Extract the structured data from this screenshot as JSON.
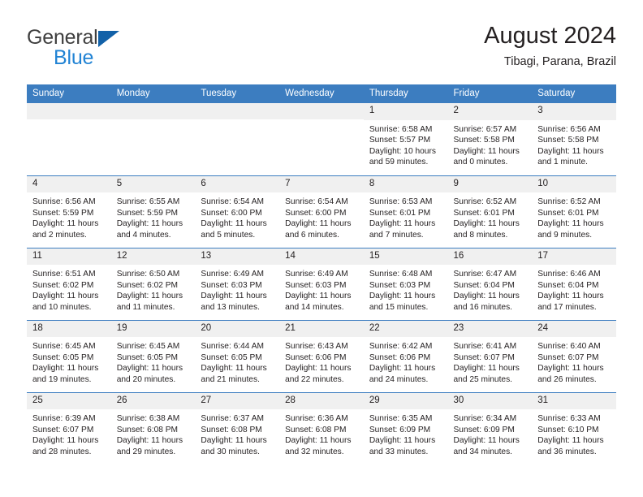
{
  "brand": {
    "name_top": "General",
    "name_bottom": "Blue",
    "triangle_color": "#1261a8",
    "blue_text_color": "#2183d4"
  },
  "header": {
    "title": "August 2024",
    "subtitle": "Tibagi, Parana, Brazil"
  },
  "theme": {
    "header_row_bg": "#3c7dc0",
    "header_row_text": "#ffffff",
    "day_number_bg": "#f0f0f0",
    "cell_text": "#231f20"
  },
  "weekday_headers": [
    "Sunday",
    "Monday",
    "Tuesday",
    "Wednesday",
    "Thursday",
    "Friday",
    "Saturday"
  ],
  "weeks": [
    [
      {
        "day": "",
        "sunrise": "",
        "sunset": "",
        "daylight": "",
        "empty": true
      },
      {
        "day": "",
        "sunrise": "",
        "sunset": "",
        "daylight": "",
        "empty": true
      },
      {
        "day": "",
        "sunrise": "",
        "sunset": "",
        "daylight": "",
        "empty": true
      },
      {
        "day": "",
        "sunrise": "",
        "sunset": "",
        "daylight": "",
        "empty": true
      },
      {
        "day": "1",
        "sunrise": "Sunrise: 6:58 AM",
        "sunset": "Sunset: 5:57 PM",
        "daylight": "Daylight: 10 hours and 59 minutes."
      },
      {
        "day": "2",
        "sunrise": "Sunrise: 6:57 AM",
        "sunset": "Sunset: 5:58 PM",
        "daylight": "Daylight: 11 hours and 0 minutes."
      },
      {
        "day": "3",
        "sunrise": "Sunrise: 6:56 AM",
        "sunset": "Sunset: 5:58 PM",
        "daylight": "Daylight: 11 hours and 1 minute."
      }
    ],
    [
      {
        "day": "4",
        "sunrise": "Sunrise: 6:56 AM",
        "sunset": "Sunset: 5:59 PM",
        "daylight": "Daylight: 11 hours and 2 minutes."
      },
      {
        "day": "5",
        "sunrise": "Sunrise: 6:55 AM",
        "sunset": "Sunset: 5:59 PM",
        "daylight": "Daylight: 11 hours and 4 minutes."
      },
      {
        "day": "6",
        "sunrise": "Sunrise: 6:54 AM",
        "sunset": "Sunset: 6:00 PM",
        "daylight": "Daylight: 11 hours and 5 minutes."
      },
      {
        "day": "7",
        "sunrise": "Sunrise: 6:54 AM",
        "sunset": "Sunset: 6:00 PM",
        "daylight": "Daylight: 11 hours and 6 minutes."
      },
      {
        "day": "8",
        "sunrise": "Sunrise: 6:53 AM",
        "sunset": "Sunset: 6:01 PM",
        "daylight": "Daylight: 11 hours and 7 minutes."
      },
      {
        "day": "9",
        "sunrise": "Sunrise: 6:52 AM",
        "sunset": "Sunset: 6:01 PM",
        "daylight": "Daylight: 11 hours and 8 minutes."
      },
      {
        "day": "10",
        "sunrise": "Sunrise: 6:52 AM",
        "sunset": "Sunset: 6:01 PM",
        "daylight": "Daylight: 11 hours and 9 minutes."
      }
    ],
    [
      {
        "day": "11",
        "sunrise": "Sunrise: 6:51 AM",
        "sunset": "Sunset: 6:02 PM",
        "daylight": "Daylight: 11 hours and 10 minutes."
      },
      {
        "day": "12",
        "sunrise": "Sunrise: 6:50 AM",
        "sunset": "Sunset: 6:02 PM",
        "daylight": "Daylight: 11 hours and 11 minutes."
      },
      {
        "day": "13",
        "sunrise": "Sunrise: 6:49 AM",
        "sunset": "Sunset: 6:03 PM",
        "daylight": "Daylight: 11 hours and 13 minutes."
      },
      {
        "day": "14",
        "sunrise": "Sunrise: 6:49 AM",
        "sunset": "Sunset: 6:03 PM",
        "daylight": "Daylight: 11 hours and 14 minutes."
      },
      {
        "day": "15",
        "sunrise": "Sunrise: 6:48 AM",
        "sunset": "Sunset: 6:03 PM",
        "daylight": "Daylight: 11 hours and 15 minutes."
      },
      {
        "day": "16",
        "sunrise": "Sunrise: 6:47 AM",
        "sunset": "Sunset: 6:04 PM",
        "daylight": "Daylight: 11 hours and 16 minutes."
      },
      {
        "day": "17",
        "sunrise": "Sunrise: 6:46 AM",
        "sunset": "Sunset: 6:04 PM",
        "daylight": "Daylight: 11 hours and 17 minutes."
      }
    ],
    [
      {
        "day": "18",
        "sunrise": "Sunrise: 6:45 AM",
        "sunset": "Sunset: 6:05 PM",
        "daylight": "Daylight: 11 hours and 19 minutes."
      },
      {
        "day": "19",
        "sunrise": "Sunrise: 6:45 AM",
        "sunset": "Sunset: 6:05 PM",
        "daylight": "Daylight: 11 hours and 20 minutes."
      },
      {
        "day": "20",
        "sunrise": "Sunrise: 6:44 AM",
        "sunset": "Sunset: 6:05 PM",
        "daylight": "Daylight: 11 hours and 21 minutes."
      },
      {
        "day": "21",
        "sunrise": "Sunrise: 6:43 AM",
        "sunset": "Sunset: 6:06 PM",
        "daylight": "Daylight: 11 hours and 22 minutes."
      },
      {
        "day": "22",
        "sunrise": "Sunrise: 6:42 AM",
        "sunset": "Sunset: 6:06 PM",
        "daylight": "Daylight: 11 hours and 24 minutes."
      },
      {
        "day": "23",
        "sunrise": "Sunrise: 6:41 AM",
        "sunset": "Sunset: 6:07 PM",
        "daylight": "Daylight: 11 hours and 25 minutes."
      },
      {
        "day": "24",
        "sunrise": "Sunrise: 6:40 AM",
        "sunset": "Sunset: 6:07 PM",
        "daylight": "Daylight: 11 hours and 26 minutes."
      }
    ],
    [
      {
        "day": "25",
        "sunrise": "Sunrise: 6:39 AM",
        "sunset": "Sunset: 6:07 PM",
        "daylight": "Daylight: 11 hours and 28 minutes."
      },
      {
        "day": "26",
        "sunrise": "Sunrise: 6:38 AM",
        "sunset": "Sunset: 6:08 PM",
        "daylight": "Daylight: 11 hours and 29 minutes."
      },
      {
        "day": "27",
        "sunrise": "Sunrise: 6:37 AM",
        "sunset": "Sunset: 6:08 PM",
        "daylight": "Daylight: 11 hours and 30 minutes."
      },
      {
        "day": "28",
        "sunrise": "Sunrise: 6:36 AM",
        "sunset": "Sunset: 6:08 PM",
        "daylight": "Daylight: 11 hours and 32 minutes."
      },
      {
        "day": "29",
        "sunrise": "Sunrise: 6:35 AM",
        "sunset": "Sunset: 6:09 PM",
        "daylight": "Daylight: 11 hours and 33 minutes."
      },
      {
        "day": "30",
        "sunrise": "Sunrise: 6:34 AM",
        "sunset": "Sunset: 6:09 PM",
        "daylight": "Daylight: 11 hours and 34 minutes."
      },
      {
        "day": "31",
        "sunrise": "Sunrise: 6:33 AM",
        "sunset": "Sunset: 6:10 PM",
        "daylight": "Daylight: 11 hours and 36 minutes."
      }
    ]
  ]
}
